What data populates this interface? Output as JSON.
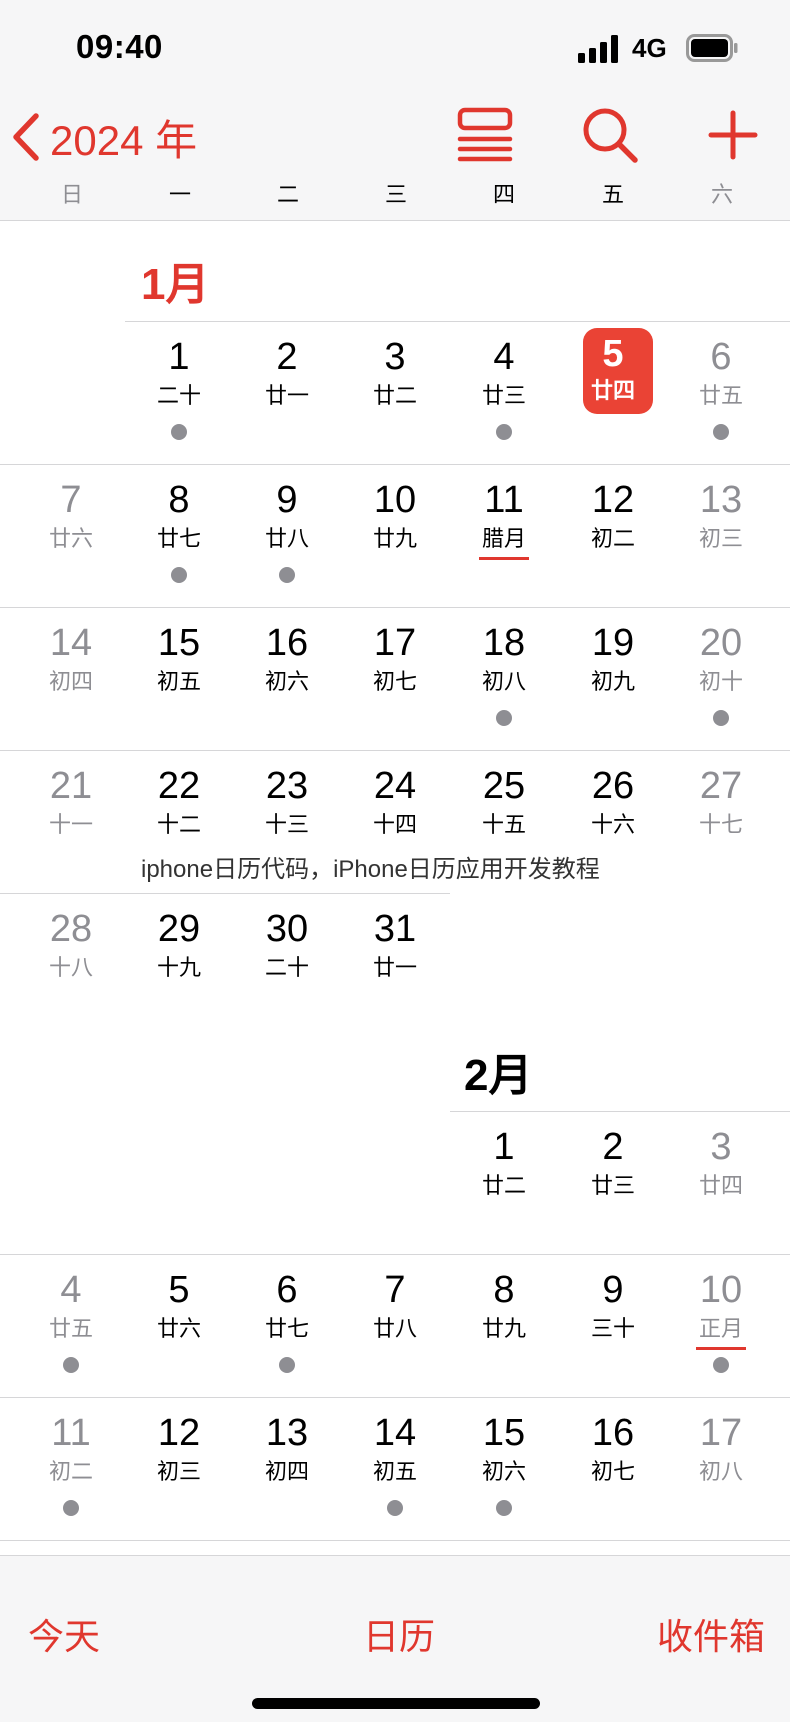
{
  "status_bar": {
    "time": "09:40",
    "network": "4G"
  },
  "header": {
    "back_label": "2024 年"
  },
  "weekdays": [
    "日",
    "一",
    "二",
    "三",
    "四",
    "五",
    "六"
  ],
  "accent_color": "#e0372e",
  "today_color": "#ea4335",
  "months": [
    {
      "title": "1月",
      "days": [
        {
          "n": "1",
          "l": "二十",
          "dot": true
        },
        {
          "n": "2",
          "l": "廿一"
        },
        {
          "n": "3",
          "l": "廿二"
        },
        {
          "n": "4",
          "l": "廿三",
          "dot": true
        },
        {
          "n": "5",
          "l": "廿四",
          "today": true
        },
        {
          "n": "6",
          "l": "廿五",
          "dot": true
        },
        {
          "n": "7",
          "l": "廿六"
        },
        {
          "n": "8",
          "l": "廿七",
          "dot": true
        },
        {
          "n": "9",
          "l": "廿八",
          "dot": true
        },
        {
          "n": "10",
          "l": "廿九"
        },
        {
          "n": "11",
          "l": "腊月",
          "underline": true
        },
        {
          "n": "12",
          "l": "初二"
        },
        {
          "n": "13",
          "l": "初三"
        },
        {
          "n": "14",
          "l": "初四"
        },
        {
          "n": "15",
          "l": "初五"
        },
        {
          "n": "16",
          "l": "初六"
        },
        {
          "n": "17",
          "l": "初七"
        },
        {
          "n": "18",
          "l": "初八",
          "dot": true
        },
        {
          "n": "19",
          "l": "初九"
        },
        {
          "n": "20",
          "l": "初十",
          "dot": true
        },
        {
          "n": "21",
          "l": "十一"
        },
        {
          "n": "22",
          "l": "十二"
        },
        {
          "n": "23",
          "l": "十三"
        },
        {
          "n": "24",
          "l": "十四"
        },
        {
          "n": "25",
          "l": "十五"
        },
        {
          "n": "26",
          "l": "十六"
        },
        {
          "n": "27",
          "l": "十七"
        },
        {
          "n": "28",
          "l": "十八"
        },
        {
          "n": "29",
          "l": "十九"
        },
        {
          "n": "30",
          "l": "二十"
        },
        {
          "n": "31",
          "l": "廿一"
        }
      ]
    },
    {
      "title": "2月",
      "days": [
        {
          "n": "1",
          "l": "廿二"
        },
        {
          "n": "2",
          "l": "廿三"
        },
        {
          "n": "3",
          "l": "廿四"
        },
        {
          "n": "4",
          "l": "廿五",
          "dot": true
        },
        {
          "n": "5",
          "l": "廿六"
        },
        {
          "n": "6",
          "l": "廿七",
          "dot": true
        },
        {
          "n": "7",
          "l": "廿八"
        },
        {
          "n": "8",
          "l": "廿九"
        },
        {
          "n": "9",
          "l": "三十"
        },
        {
          "n": "10",
          "l": "正月",
          "underline": true,
          "dot": true
        },
        {
          "n": "11",
          "l": "初二",
          "dot": true
        },
        {
          "n": "12",
          "l": "初三"
        },
        {
          "n": "13",
          "l": "初四"
        },
        {
          "n": "14",
          "l": "初五",
          "dot": true
        },
        {
          "n": "15",
          "l": "初六",
          "dot": true
        },
        {
          "n": "16",
          "l": "初七"
        },
        {
          "n": "17",
          "l": "初八"
        }
      ]
    }
  ],
  "caption": "iphone日历代码，iPhone日历应用开发教程",
  "tabs": {
    "today": "今天",
    "calendars": "日历",
    "inbox": "收件箱"
  }
}
